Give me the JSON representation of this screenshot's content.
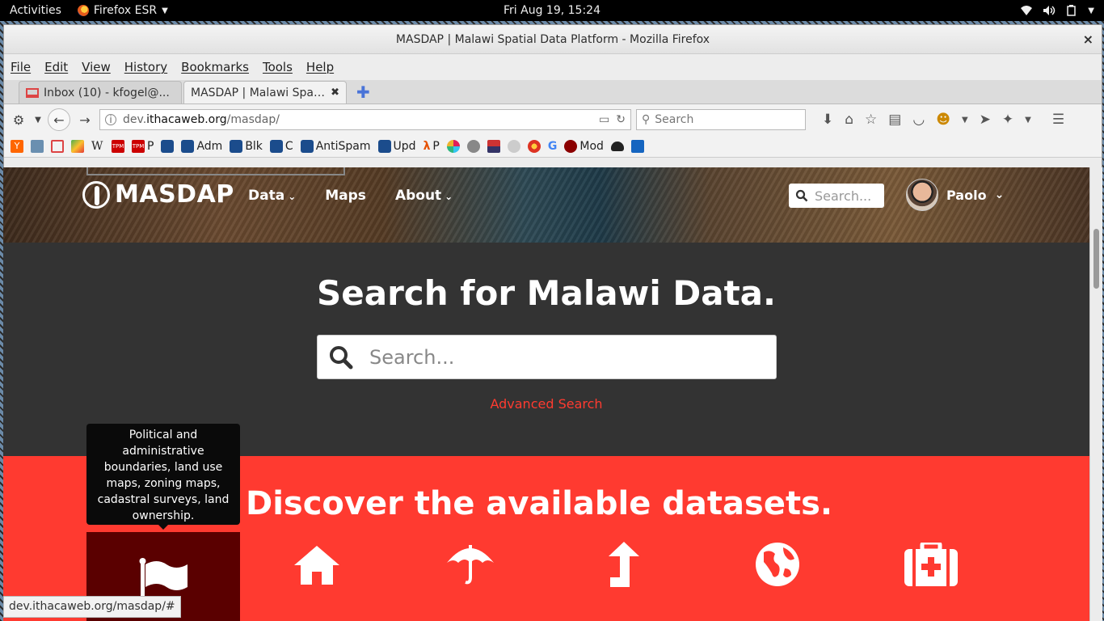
{
  "gnome": {
    "activities": "Activities",
    "app_name": "Firefox ESR",
    "clock": "Fri Aug 19, 15:24"
  },
  "window": {
    "title": "MASDAP | Malawi Spatial Data Platform - Mozilla Firefox",
    "close": "×"
  },
  "menu": [
    "File",
    "Edit",
    "View",
    "History",
    "Bookmarks",
    "Tools",
    "Help"
  ],
  "tabs": [
    {
      "label": "Inbox (10) - kfogel@..."
    },
    {
      "label": "MASDAP | Malawi Spatia..."
    }
  ],
  "url": {
    "prefix": "dev.",
    "domain": "ithacaweb.org",
    "path": "/masdap/"
  },
  "browser_search_placeholder": "Search",
  "bookmarks": [
    {
      "label": "",
      "icon": "y-combinator-icon"
    },
    {
      "label": "",
      "icon": "grid-icon"
    },
    {
      "label": "",
      "icon": "gmail-icon"
    },
    {
      "label": "",
      "icon": "maps-icon"
    },
    {
      "label": "",
      "icon": "wikipedia-icon"
    },
    {
      "label": "",
      "icon": "tpm-icon"
    },
    {
      "label": "P",
      "icon": "tpm-icon"
    },
    {
      "label": "",
      "icon": "debian-icon"
    },
    {
      "label": "Adm",
      "icon": "debian-icon"
    },
    {
      "label": "Blk",
      "icon": "debian-icon"
    },
    {
      "label": "C",
      "icon": "debian-icon"
    },
    {
      "label": "AntiSpam",
      "icon": "debian-icon"
    },
    {
      "label": "Upd",
      "icon": "debian-icon"
    },
    {
      "label": "P",
      "icon": "lambda-icon"
    },
    {
      "label": "",
      "icon": "slack-icon"
    },
    {
      "label": "",
      "icon": "gnu-icon"
    },
    {
      "label": "",
      "icon": "mailman-icon"
    },
    {
      "label": "",
      "icon": "tool-icon"
    },
    {
      "label": "",
      "icon": "firefox-addon-icon"
    },
    {
      "label": "",
      "icon": "google-icon"
    },
    {
      "label": "Mod",
      "icon": "red-circle-icon"
    },
    {
      "label": "",
      "icon": "burger-icon"
    },
    {
      "label": "",
      "icon": "reply-icon"
    }
  ],
  "site": {
    "logo_text": "MASDAP",
    "nav": [
      {
        "label": "Data",
        "dropdown": true
      },
      {
        "label": "Maps",
        "dropdown": false
      },
      {
        "label": "About",
        "dropdown": true
      }
    ],
    "search_placeholder": "Search...",
    "user_name": "Paolo",
    "hero_heading": "Search for Malawi Data.",
    "big_search_placeholder": "Search...",
    "advanced_search": "Advanced Search",
    "discover_heading": "Discover the available datasets.",
    "tooltip": "Political and administrative boundaries, land use maps, zoning maps, cadastral surveys, land ownership.",
    "categories": [
      "flag-icon",
      "house-icon",
      "umbrella-icon",
      "arrow-up-icon",
      "globe-icon",
      "first-aid-icon"
    ]
  },
  "status_url": "dev.ithacaweb.org/masdap/#",
  "colors": {
    "accent_red": "#ff3a30",
    "dark_band": "#333333",
    "selected_category": "#5a0000"
  }
}
